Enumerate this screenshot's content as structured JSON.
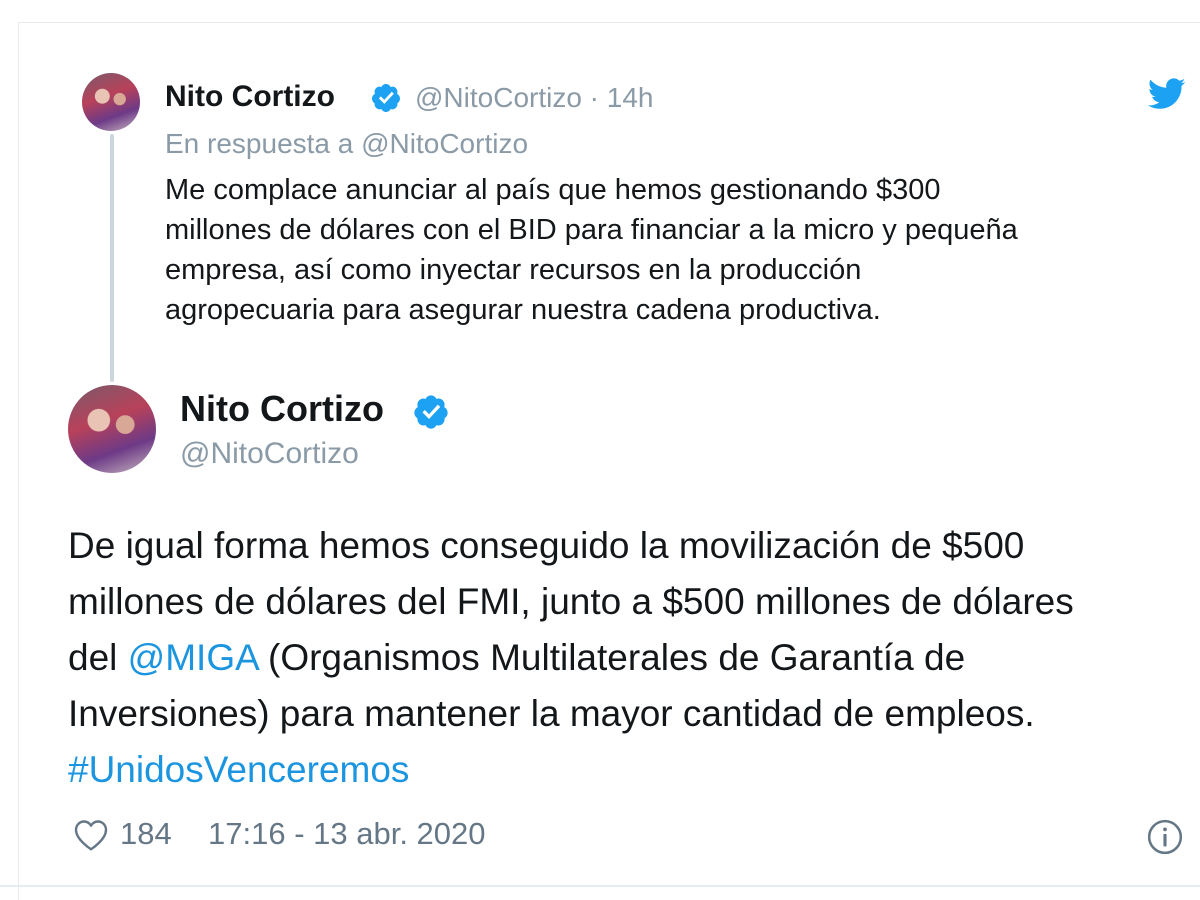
{
  "quoted_tweet": {
    "display_name": "Nito Cortizo",
    "handle_time": "@NitoCortizo · 14h",
    "reply_to": "En respuesta a @NitoCortizo",
    "body_lines": [
      "Me complace anunciar al país que hemos gestionando $300",
      "millones de dólares con el BID para financiar a la micro y pequeña",
      "empresa, así como inyectar recursos en la producción",
      "agropecuaria para asegurar nuestra cadena productiva."
    ]
  },
  "main_tweet": {
    "display_name": "Nito Cortizo",
    "handle": "@NitoCortizo",
    "body": {
      "line1": "De igual forma hemos conseguido la movilización de $500",
      "line2": "millones de dólares del FMI, junto a $500 millones de dólares",
      "line3_prefix": "del ",
      "line3_mention": "@MIGA",
      "line3_suffix": " (Organismos Multilaterales de Garantía de",
      "line4": "Inversiones) para mantener la mayor cantidad de empleos.",
      "hashtag": "#UnidosVenceremos"
    },
    "likes": "184",
    "timestamp": "17:16 - 13 abr. 2020"
  },
  "icons": {
    "verified": "verified-badge-icon",
    "brand": "twitter-bird-icon",
    "like": "heart-icon",
    "info": "info-icon"
  },
  "colors": {
    "accent": "#1da1f2",
    "link": "#1b95e0",
    "muted": "#8a9aa6"
  }
}
